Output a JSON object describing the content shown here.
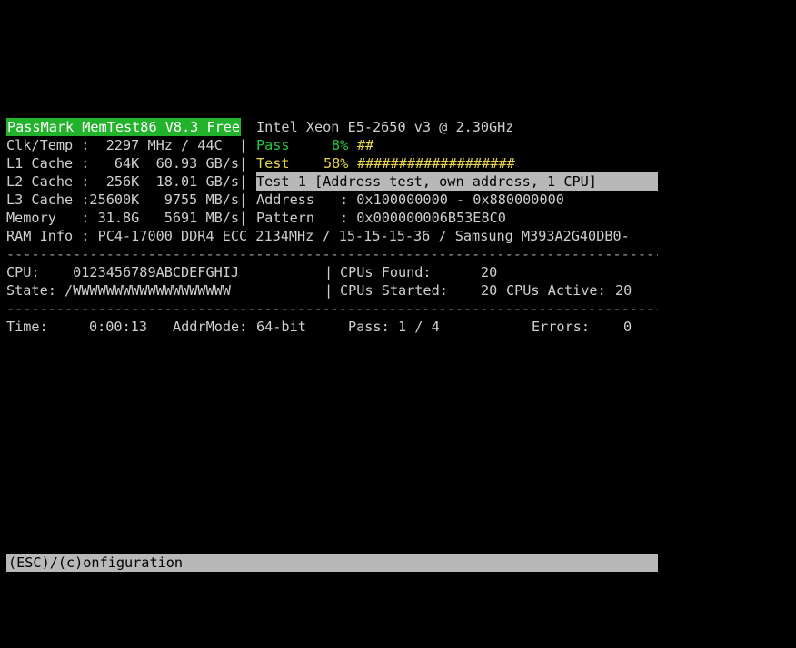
{
  "header": {
    "title": "PassMark MemTest86 V8.3 Free",
    "cpu_model": "Intel Xeon E5-2650 v3 @ 2.30GHz"
  },
  "system": {
    "clk_temp": "Clk/Temp :  2297 MHz / 44C  |",
    "l1_cache": "L1 Cache :   64K  60.93 GB/s|",
    "l2_cache": "L2 Cache :  256K  18.01 GB/s|",
    "l3_cache": "L3 Cache :25600K   9755 MB/s|",
    "memory": "Memory   : 31.8G   5691 MB/s|"
  },
  "progress": {
    "pass_label": "Pass",
    "pass_pct": "8%",
    "pass_bar": "##",
    "pass_fraction": 0.08,
    "test_label": "Test",
    "test_pct": "58%",
    "test_bar": "###################",
    "test_fraction": 0.58
  },
  "test": {
    "current": "Test 1 [Address test, own address, 1 CPU]",
    "address_label": "Address",
    "address_value": ": 0x100000000 - 0x880000000",
    "pattern_label": "Pattern",
    "pattern_value": ": 0x000000006B53E8C0"
  },
  "ram_info": "RAM Info : PC4-17000 DDR4 ECC 2134MHz / 15-15-15-36 / Samsung M393A2G40DB0-",
  "divider": "----------------------------------------------------------------------------------------------",
  "cpu": {
    "cpu_line": "CPU:    0123456789ABCDEFGHIJ",
    "state_line": "State: /WWWWWWWWWWWWWWWWWWW",
    "sep": "|",
    "found_label": "CPUs Found:",
    "found_value": "20",
    "started_label": "CPUs Started:",
    "started_value": "20",
    "active_label": "CPUs Active:",
    "active_value": "20"
  },
  "stats": {
    "time_label": "Time:",
    "time_value": "0:00:13",
    "addrmode_label": "AddrMode:",
    "addrmode_value": "64-bit",
    "pass_label": "Pass:",
    "pass_value": "1 / 4",
    "errors_label": "Errors:",
    "errors_value": "0"
  },
  "status_bar": "(ESC)/(c)onfiguration",
  "colors": {
    "background": "#000000",
    "text": "#cfcfcf",
    "title_bg": "#22b22c",
    "pass_green": "#25c93a",
    "test_yellow": "#e6d44a",
    "highlight_bar": "#b8b8b8"
  }
}
